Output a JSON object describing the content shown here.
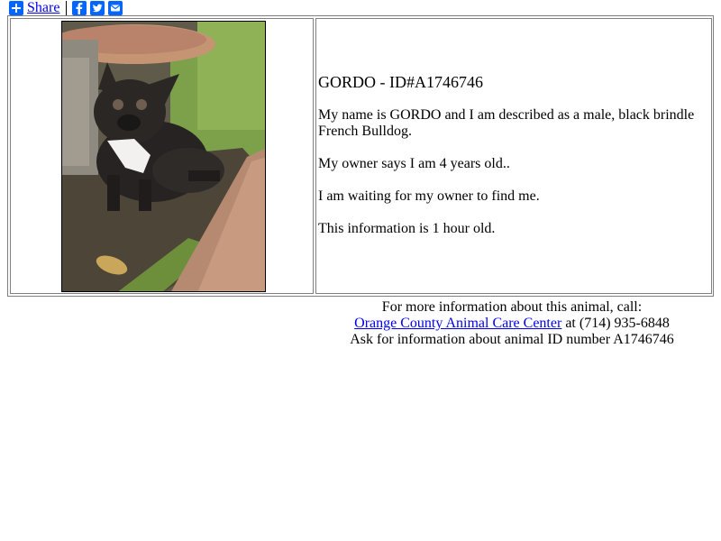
{
  "share_bar": {
    "share_label": "Share"
  },
  "pet": {
    "title": "GORDO - ID#A1746746",
    "description": "My name is GORDO and I am described as a male, black brindle French Bulldog.",
    "age_text": "My owner says I am 4 years old..",
    "status_text": "I am waiting for my owner to find me.",
    "freshness_text": "This information is 1 hour old."
  },
  "contact": {
    "line1": "For more information about this animal, call:",
    "shelter_name": "Orange County Animal Care Center",
    "phone_text": " at (714) 935-6848",
    "line3": "Ask for information about animal ID number A1746746"
  },
  "colors": {
    "link": "#0000ee",
    "share_blue": "#0166ff",
    "border": "#808080"
  },
  "icons": [
    "plus-icon",
    "facebook-icon",
    "twitter-icon",
    "email-icon"
  ]
}
